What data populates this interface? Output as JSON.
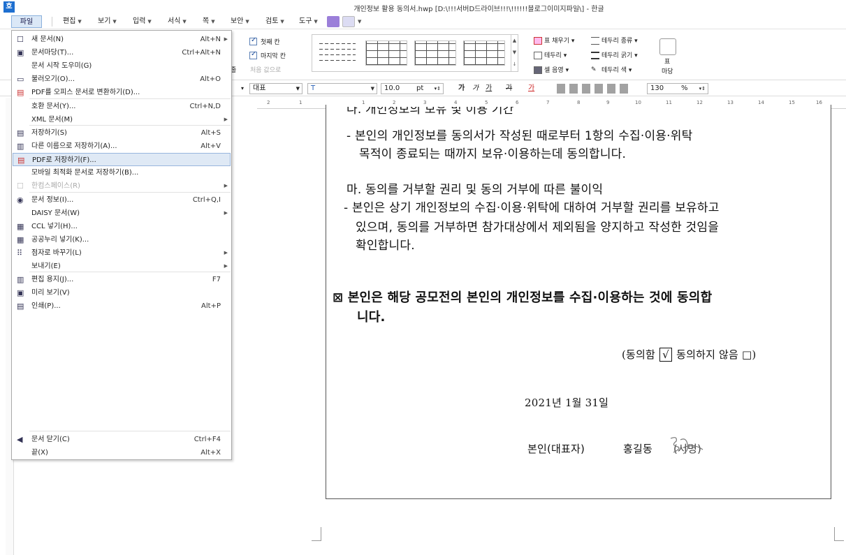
{
  "window": {
    "app_icon": "호",
    "title": "개인정보 활용 동의서.hwp [D:\\!!!서버D드라이브!!!\\!!!!!!블로그이미지파일\\] - 한글"
  },
  "menubar": {
    "items": [
      {
        "label": "파일"
      },
      {
        "label": "편집"
      },
      {
        "label": "보기"
      },
      {
        "label": "입력"
      },
      {
        "label": "서식"
      },
      {
        "label": "쪽"
      },
      {
        "label": "보안"
      },
      {
        "label": "검토"
      },
      {
        "label": "도구"
      }
    ]
  },
  "toolbar": {
    "first_col": "첫째 칸",
    "last_col": "마지막 칸",
    "cut_label": "줄",
    "same_value": "처음 값으로",
    "fill": "표 채우기",
    "border": "테두리",
    "cell_shade": "셀 음영",
    "border_type": "테두리 종류",
    "border_width": "테두리 굵기",
    "border_color": "테두리 색",
    "table": "표",
    "margin": "마당"
  },
  "format": {
    "style": "대표",
    "font_icon": "T",
    "size": "10.0",
    "unit": "pt",
    "bold": "가",
    "italic": "가",
    "underline": "가",
    "strike": "가",
    "color": "가",
    "zoom": "130",
    "zoom_unit": "%"
  },
  "ruler": {
    "ticks": [
      "2",
      "1",
      "1",
      "2",
      "3",
      "4",
      "5",
      "6",
      "7",
      "8",
      "9",
      "10",
      "11",
      "12",
      "13",
      "14",
      "15",
      "16"
    ]
  },
  "file_menu": {
    "items": [
      {
        "label": "새 문서(N)",
        "shortcut": "Alt+N",
        "icon": "new-document-icon",
        "submenu": true
      },
      {
        "label": "문서마당(T)...",
        "shortcut": "Ctrl+Alt+N",
        "icon": "template-icon"
      },
      {
        "label": "문서 시작 도우미(G)",
        "shortcut": "",
        "icon": ""
      },
      {
        "label": "불러오기(O)...",
        "shortcut": "Alt+O",
        "icon": "open-folder-icon"
      },
      {
        "label": "PDF를 오피스 문서로 변환하기(D)...",
        "shortcut": "",
        "icon": "pdf-convert-icon"
      },
      {
        "label": "호환 문서(Y)...",
        "shortcut": "Ctrl+N,D",
        "icon": ""
      },
      {
        "label": "XML 문서(M)",
        "shortcut": "",
        "icon": "",
        "submenu": true
      },
      {
        "label": "저장하기(S)",
        "shortcut": "Alt+S",
        "icon": "save-icon"
      },
      {
        "label": "다른 이름으로 저장하기(A)...",
        "shortcut": "Alt+V",
        "icon": "save-as-icon"
      },
      {
        "label": "PDF로 저장하기(F)...",
        "shortcut": "",
        "icon": "pdf-save-icon",
        "highlight": true
      },
      {
        "label": "모바일 최적화 문서로 저장하기(B)...",
        "shortcut": "",
        "icon": ""
      },
      {
        "label": "한컴스페이스(R)",
        "shortcut": "",
        "icon": "cloud-icon",
        "submenu": true,
        "disabled": true
      },
      {
        "label": "문서 정보(I)...",
        "shortcut": "Ctrl+Q,I",
        "icon": "info-icon"
      },
      {
        "label": "DAISY 문서(W)",
        "shortcut": "",
        "icon": "",
        "submenu": true
      },
      {
        "label": "CCL 넣기(H)...",
        "shortcut": "",
        "icon": "ccl-icon"
      },
      {
        "label": "공공누리 넣기(K)...",
        "shortcut": "",
        "icon": "kogl-icon"
      },
      {
        "label": "점자로 바꾸기(L)",
        "shortcut": "",
        "icon": "braille-icon",
        "submenu": true
      },
      {
        "label": "보내기(E)",
        "shortcut": "",
        "icon": "",
        "submenu": true
      },
      {
        "label": "편집 용지(J)...",
        "shortcut": "F7",
        "icon": "page-setup-icon"
      },
      {
        "label": "미리 보기(V)",
        "shortcut": "",
        "icon": "preview-icon"
      },
      {
        "label": "인쇄(P)...",
        "shortcut": "Alt+P",
        "icon": "print-icon"
      },
      {
        "label": "문서 닫기(C)",
        "shortcut": "Ctrl+F4",
        "icon": "close-doc-icon"
      },
      {
        "label": "끝(X)",
        "shortcut": "Alt+X",
        "icon": ""
      }
    ]
  },
  "document": {
    "line_cut": "다. 개인정보의 보유 및 이용 기간",
    "p1a": "- 본인의 개인정보를 동의서가 작성된 때로부터 1항의 수집·이용·위탁",
    "p1b": "목적이 종료되는 때까지 보유·이용하는데 동의합니다.",
    "h2": "마. 동의를 거부할 권리 및 동의 거부에 따른 불이익",
    "p2a": "- 본인은 상기 개인정보의 수집·이용·위탁에 대하여 거부할 권리를 보유하고",
    "p2b": "있으며, 동의를 거부하면 참가대상에서 제외됨을 양지하고 작성한 것임을",
    "p2c": "확인합니다.",
    "b1": "⊠ 본인은 해당 공모전의 본인의 개인정보를 수집·이용하는 것에    동의합",
    "b2": "니다.",
    "agree_label": "(동의함",
    "agree_mark": "√",
    "disagree_label": "동의하지 않음 □)",
    "date": "2021년  1월  31일",
    "person_label": "본인(대표자)",
    "person_name": "홍길동",
    "sign_label": "(서명)"
  }
}
